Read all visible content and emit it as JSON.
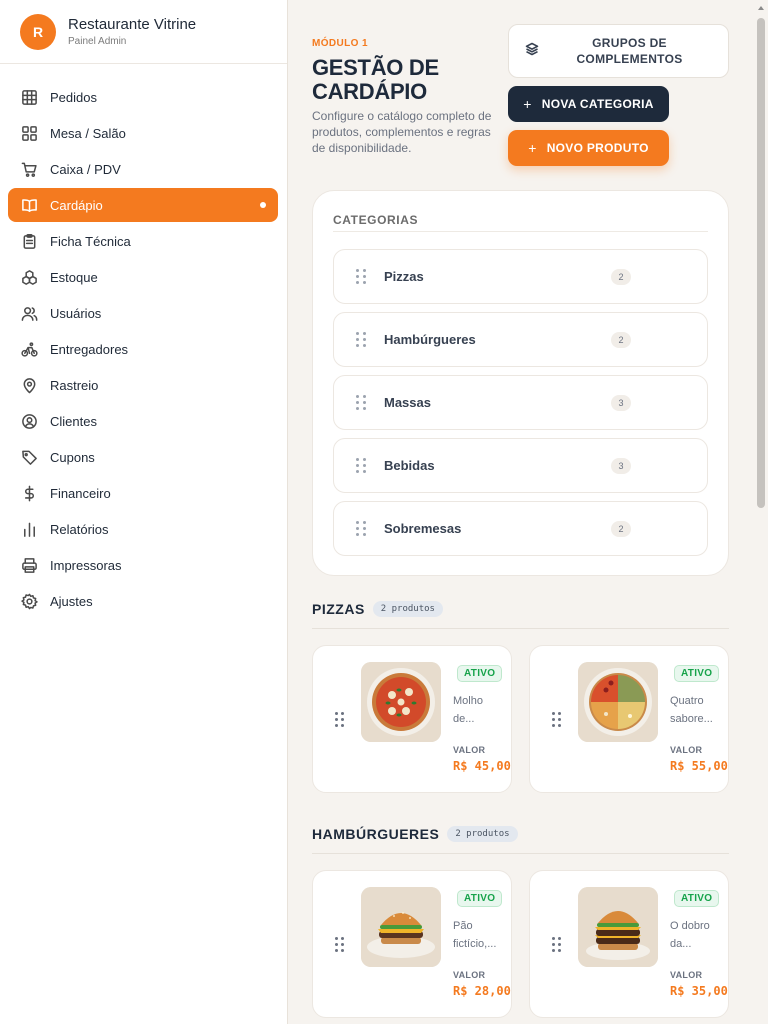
{
  "brand": {
    "initial": "R",
    "name": "Restaurante Vitrine",
    "subtitle": "Painel Admin"
  },
  "nav": [
    {
      "label": "Pedidos",
      "icon": "grid-icon"
    },
    {
      "label": "Mesa / Salão",
      "icon": "tables-icon"
    },
    {
      "label": "Caixa / PDV",
      "icon": "cart-icon"
    },
    {
      "label": "Cardápio",
      "icon": "book-icon",
      "active": true
    },
    {
      "label": "Ficha Técnica",
      "icon": "clipboard-icon"
    },
    {
      "label": "Estoque",
      "icon": "boxes-icon"
    },
    {
      "label": "Usuários",
      "icon": "users-icon"
    },
    {
      "label": "Entregadores",
      "icon": "bike-icon"
    },
    {
      "label": "Rastreio",
      "icon": "map-pin-icon"
    },
    {
      "label": "Clientes",
      "icon": "user-circle-icon"
    },
    {
      "label": "Cupons",
      "icon": "tag-icon"
    },
    {
      "label": "Financeiro",
      "icon": "dollar-icon"
    },
    {
      "label": "Relatórios",
      "icon": "bar-chart-icon"
    },
    {
      "label": "Impressoras",
      "icon": "printer-icon"
    },
    {
      "label": "Ajustes",
      "icon": "gear-icon"
    }
  ],
  "header": {
    "module": "MÓDULO 1",
    "title": "GESTÃO DE CARDÁPIO",
    "description": "Configure o catálogo completo de produtos, complementos e regras de disponibilidade."
  },
  "actions": {
    "groups": "GRUPOS DE COMPLEMENTOS",
    "new_category": "NOVA CATEGORIA",
    "new_product": "NOVO PRODUTO",
    "plus": "+"
  },
  "categories": {
    "heading": "CATEGORIAS",
    "items": [
      {
        "name": "Pizzas",
        "count": "2"
      },
      {
        "name": "Hambúrgueres",
        "count": "2"
      },
      {
        "name": "Massas",
        "count": "3"
      },
      {
        "name": "Bebidas",
        "count": "3"
      },
      {
        "name": "Sobremesas",
        "count": "2"
      }
    ]
  },
  "sections": [
    {
      "title": "PIZZAS",
      "badge": "2 produtos",
      "products": [
        {
          "status": "ATIVO",
          "desc": "Molho de...",
          "value_label": "VALOR",
          "price": "R$ 45,00",
          "image": "pizza-margherita"
        },
        {
          "status": "ATIVO",
          "desc": "Quatro sabore...",
          "value_label": "VALOR",
          "price": "R$ 55,00",
          "image": "pizza-quatro-sabores"
        }
      ]
    },
    {
      "title": "HAMBÚRGUERES",
      "badge": "2 produtos",
      "products": [
        {
          "status": "ATIVO",
          "desc": "Pão fictício,...",
          "value_label": "VALOR",
          "price": "R$ 28,00",
          "image": "burger-classic"
        },
        {
          "status": "ATIVO",
          "desc": "O dobro da...",
          "value_label": "VALOR",
          "price": "R$ 35,00",
          "image": "burger-double"
        }
      ]
    }
  ],
  "colors": {
    "accent": "#f47a1f",
    "navy": "#1e2a3b",
    "success": "#16a34a"
  }
}
